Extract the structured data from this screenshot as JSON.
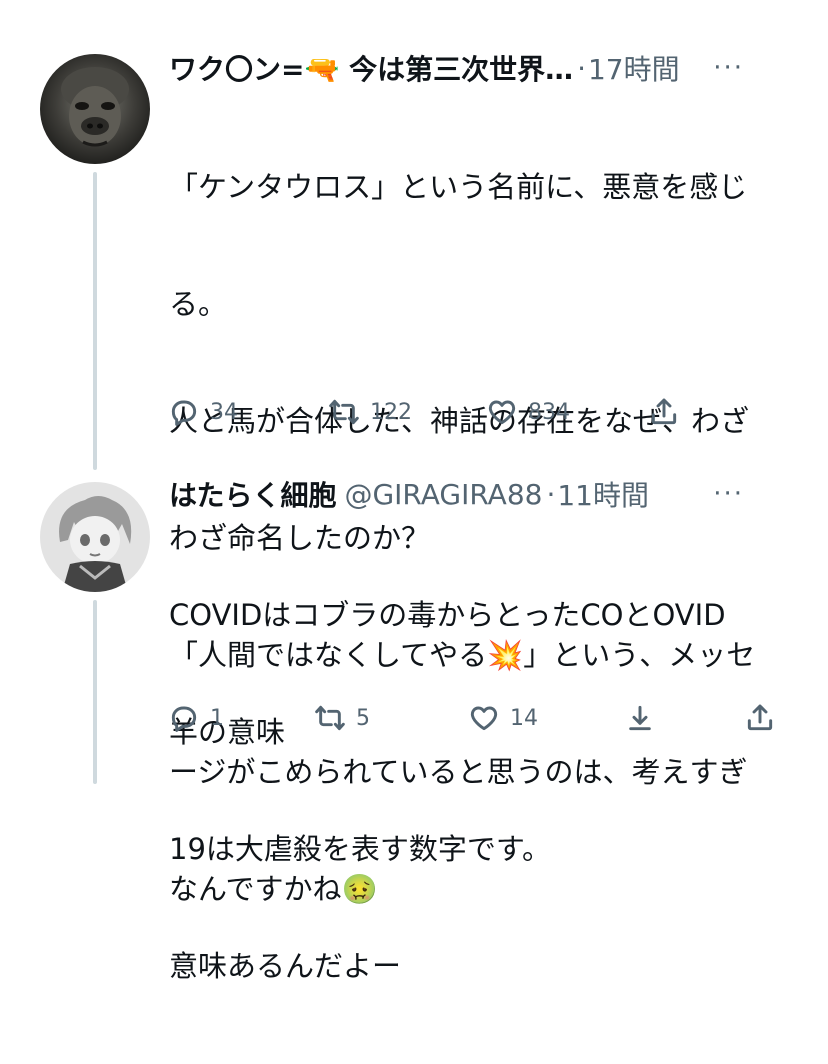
{
  "tweets": [
    {
      "name": "ワク〇ン=🔫 今は第三次世界…",
      "handle": "",
      "separator": "·",
      "time": "17時間",
      "more": "···",
      "body_lines": [
        "「ケンタウロス」という名前に、悪意を感じ",
        "る。",
        "人と馬が合体した、神話の存在をなぜ、わざ",
        "わざ命名したのか？",
        "「人間ではなくしてやる💥」という、メッセ",
        "ージがこめられていると思うのは、考えすぎ",
        "なんですかね🤢"
      ],
      "reply_count": "34",
      "retweet_count": "122",
      "like_count": "834"
    },
    {
      "name": "はたらく細胞",
      "handle": "@GIRAGIRA88",
      "separator": "·",
      "time": "11時間",
      "more": "···",
      "body_lines": [
        "COVIDはコブラの毒からとったCOとOVID",
        "羊の意味",
        "19は大虐殺を表す数字です。",
        "意味あるんだよー"
      ],
      "reply_count": "1",
      "retweet_count": "5",
      "like_count": "14"
    }
  ],
  "icons": {
    "reply": "reply-icon",
    "retweet": "retweet-icon",
    "like": "like-icon",
    "share": "share-icon",
    "download": "download-icon",
    "more": "more-icon"
  },
  "colors": {
    "text": "#0f1419",
    "secondary": "#536471",
    "thread_line": "#cfd9de"
  }
}
